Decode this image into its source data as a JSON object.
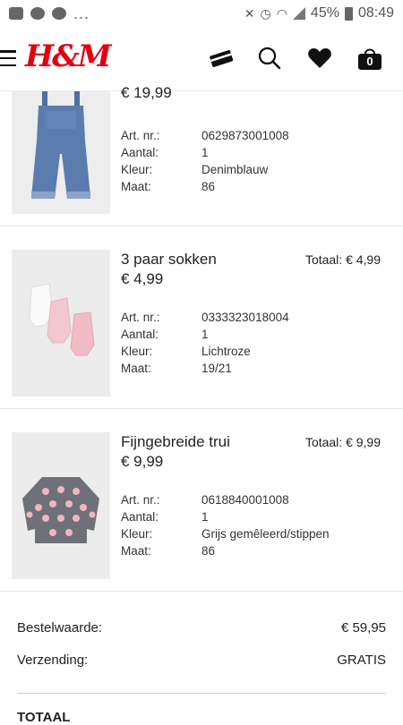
{
  "status": {
    "battery": "45%",
    "time": "08:49",
    "overflow": "..."
  },
  "header": {
    "logo": "H&M",
    "bag_count": "0"
  },
  "items": [
    {
      "name": "",
      "price": "€ 19,99",
      "total": "",
      "props": [
        {
          "k": "Art. nr.:",
          "v": "0629873001008"
        },
        {
          "k": "Aantal:",
          "v": "1"
        },
        {
          "k": "Kleur:",
          "v": "Denimblauw"
        },
        {
          "k": "Maat:",
          "v": "86"
        }
      ]
    },
    {
      "name": "3 paar sokken",
      "price": "€ 4,99",
      "total": "Totaal: € 4,99",
      "props": [
        {
          "k": "Art. nr.:",
          "v": "0333323018004"
        },
        {
          "k": "Aantal:",
          "v": "1"
        },
        {
          "k": "Kleur:",
          "v": "Lichtroze"
        },
        {
          "k": "Maat:",
          "v": "19/21"
        }
      ]
    },
    {
      "name": "Fijngebreide trui",
      "price": "€ 9,99",
      "total": "Totaal: € 9,99",
      "props": [
        {
          "k": "Art. nr.:",
          "v": "0618840001008"
        },
        {
          "k": "Aantal:",
          "v": "1"
        },
        {
          "k": "Kleur:",
          "v": "Grijs gemêleerd/stippen"
        },
        {
          "k": "Maat:",
          "v": "86"
        }
      ]
    }
  ],
  "summary": {
    "order_label": "Bestelwaarde:",
    "order_value": "€ 59,95",
    "shipping_label": "Verzending:",
    "shipping_value": "GRATIS",
    "total_label": "TOTAAL"
  }
}
